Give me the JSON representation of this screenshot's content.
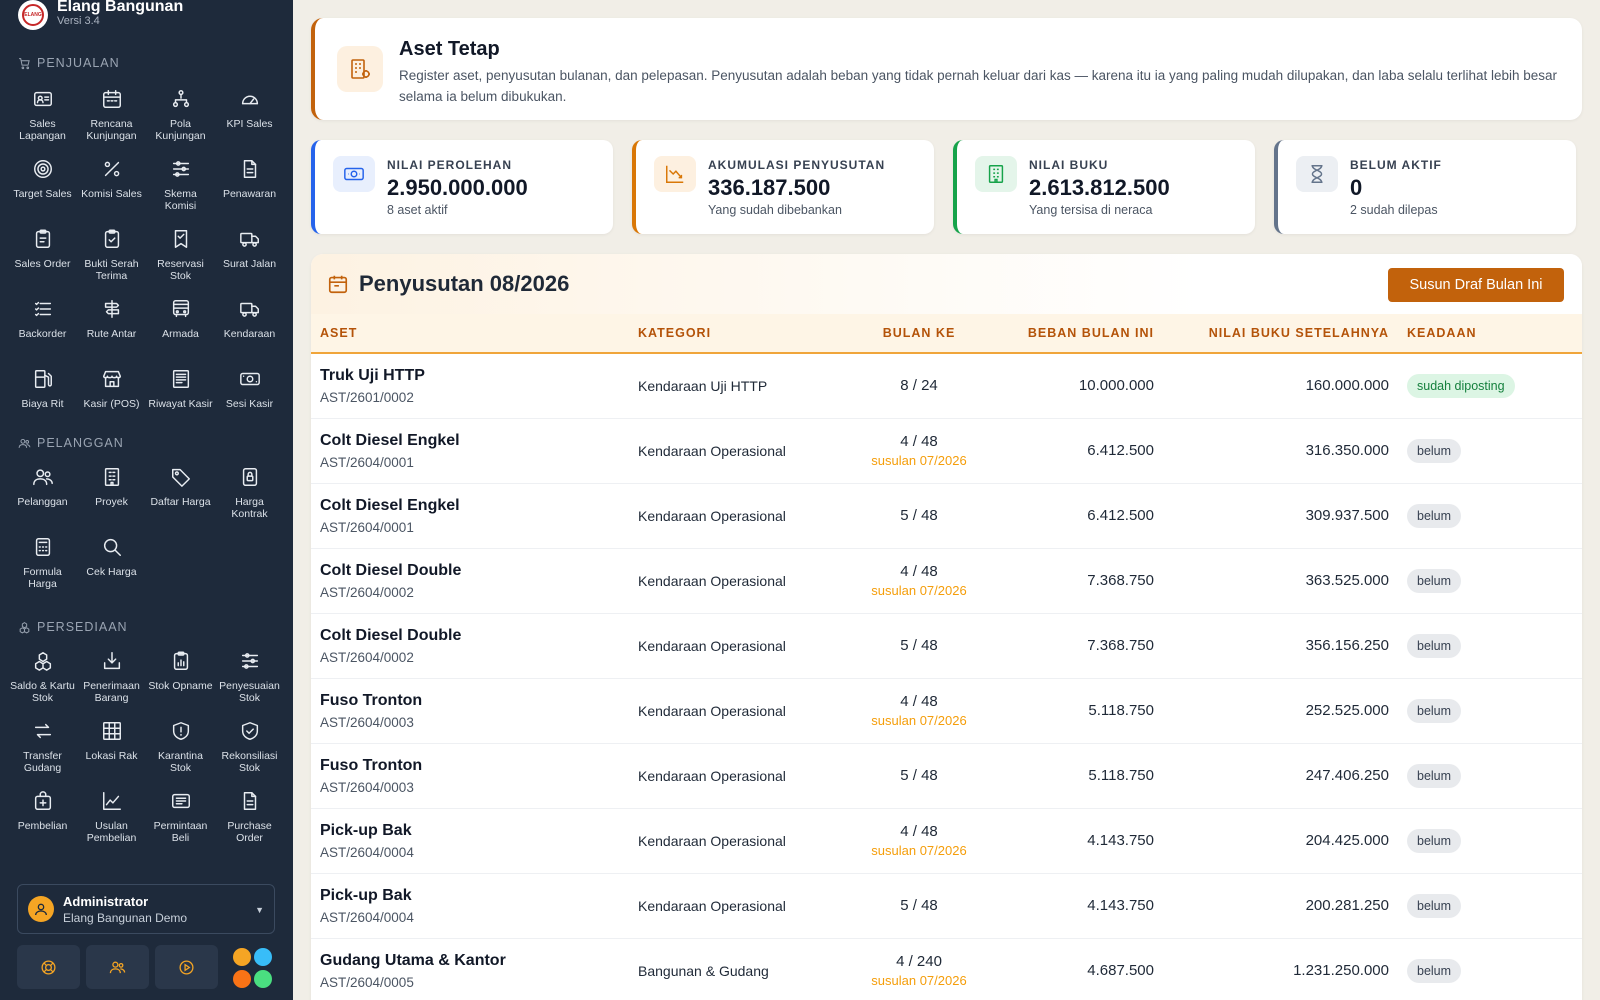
{
  "brand": {
    "name": "Elang Bangunan",
    "version": "Versi 3.4",
    "logo_text": "ELANG"
  },
  "sections": [
    {
      "title": "PENJUALAN",
      "icon": "cart-icon",
      "items": [
        {
          "label": "Sales Lapangan",
          "icon": "id-card-icon"
        },
        {
          "label": "Rencana Kunjungan",
          "icon": "calendar-icon"
        },
        {
          "label": "Pola Kunjungan",
          "icon": "network-icon"
        },
        {
          "label": "KPI Sales",
          "icon": "gauge-icon"
        },
        {
          "label": "Target Sales",
          "icon": "target-icon"
        },
        {
          "label": "Komisi Sales",
          "icon": "percent-icon"
        },
        {
          "label": "Skema Komisi",
          "icon": "sliders-icon"
        },
        {
          "label": "Penawaran",
          "icon": "document-icon"
        },
        {
          "label": "Sales Order",
          "icon": "clipboard-icon"
        },
        {
          "label": "Bukti Serah Terima",
          "icon": "clipboard-check-icon"
        },
        {
          "label": "Reservasi Stok",
          "icon": "bookmark-icon"
        },
        {
          "label": "Surat Jalan",
          "icon": "truck-icon"
        },
        {
          "label": "Backorder",
          "icon": "list-icon"
        },
        {
          "label": "Rute Antar",
          "icon": "signpost-icon"
        },
        {
          "label": "Armada",
          "icon": "bus-icon"
        },
        {
          "label": "Kendaraan",
          "icon": "truck-icon"
        },
        {
          "label": "Biaya Rit",
          "icon": "fuel-icon"
        },
        {
          "label": "Kasir (POS)",
          "icon": "store-icon"
        },
        {
          "label": "Riwayat Kasir",
          "icon": "receipt-icon"
        },
        {
          "label": "Sesi Kasir",
          "icon": "cash-icon"
        }
      ]
    },
    {
      "title": "PELANGGAN",
      "icon": "users-icon",
      "items": [
        {
          "label": "Pelanggan",
          "icon": "users-icon"
        },
        {
          "label": "Proyek",
          "icon": "building-icon"
        },
        {
          "label": "Daftar Harga",
          "icon": "tag-icon"
        },
        {
          "label": "Harga Kontrak",
          "icon": "lock-icon"
        },
        {
          "label": "Formula Harga",
          "icon": "calculator-icon"
        },
        {
          "label": "Cek Harga",
          "icon": "search-icon"
        }
      ]
    },
    {
      "title": "PERSEDIAAN",
      "icon": "boxes-icon",
      "items": [
        {
          "label": "Saldo & Kartu Stok",
          "icon": "boxes-icon"
        },
        {
          "label": "Penerimaan Barang",
          "icon": "download-tray-icon"
        },
        {
          "label": "Stok Opname",
          "icon": "clipboard-chart-icon"
        },
        {
          "label": "Penyesuaian Stok",
          "icon": "sliders-icon"
        },
        {
          "label": "Transfer Gudang",
          "icon": "arrows-icon"
        },
        {
          "label": "Lokasi Rak",
          "icon": "grid-icon"
        },
        {
          "label": "Karantina Stok",
          "icon": "shield-alert-icon"
        },
        {
          "label": "Rekonsiliasi Stok",
          "icon": "shield-check-icon"
        },
        {
          "label": "Pembelian",
          "icon": "bag-plus-icon"
        },
        {
          "label": "Usulan Pembelian",
          "icon": "chart-line-icon"
        },
        {
          "label": "Permintaan Beli",
          "icon": "form-icon"
        },
        {
          "label": "Purchase Order",
          "icon": "document-icon"
        }
      ]
    }
  ],
  "user": {
    "name": "Administrator",
    "org": "Elang Bangunan Demo"
  },
  "header": {
    "title": "Aset Tetap",
    "description": "Register aset, penyusutan bulanan, dan pelepasan. Penyusutan adalah beban yang tidak pernah keluar dari kas — karena itu ia yang paling mudah dilupakan, dan laba selalu terlihat lebih besar selama ia belum dibukukan."
  },
  "kpis": [
    {
      "label": "NILAI PEROLEHAN",
      "value": "2.950.000.000",
      "sub": "8 aset aktif",
      "color": "#2563eb",
      "icon": "money-icon"
    },
    {
      "label": "AKUMULASI PENYUSUTAN",
      "value": "336.187.500",
      "sub": "Yang sudah dibebankan",
      "color": "#d97706",
      "icon": "chart-down-icon"
    },
    {
      "label": "NILAI BUKU",
      "value": "2.613.812.500",
      "sub": "Yang tersisa di neraca",
      "color": "#16a34a",
      "icon": "building-icon"
    },
    {
      "label": "BELUM AKTIF",
      "value": "0",
      "sub": "2 sudah dilepas",
      "color": "#64748b",
      "icon": "hourglass-icon"
    }
  ],
  "depreciation": {
    "title": "Penyusutan 08/2026",
    "button": "Susun Draf Bulan Ini",
    "columns": [
      "ASET",
      "KATEGORI",
      "BULAN KE",
      "BEBAN BULAN INI",
      "NILAI BUKU SETELAHNYA",
      "KEADAAN"
    ],
    "rows": [
      {
        "name": "Truk Uji HTTP",
        "code": "AST/2601/0002",
        "category": "Kendaraan Uji HTTP",
        "month": "8 / 24",
        "late": "",
        "expense": "10.000.000",
        "book": "160.000.000",
        "status": "sudah diposting",
        "posted": true
      },
      {
        "name": "Colt Diesel Engkel",
        "code": "AST/2604/0001",
        "category": "Kendaraan Operasional",
        "month": "4 / 48",
        "late": "susulan 07/2026",
        "expense": "6.412.500",
        "book": "316.350.000",
        "status": "belum",
        "posted": false
      },
      {
        "name": "Colt Diesel Engkel",
        "code": "AST/2604/0001",
        "category": "Kendaraan Operasional",
        "month": "5 / 48",
        "late": "",
        "expense": "6.412.500",
        "book": "309.937.500",
        "status": "belum",
        "posted": false
      },
      {
        "name": "Colt Diesel Double",
        "code": "AST/2604/0002",
        "category": "Kendaraan Operasional",
        "month": "4 / 48",
        "late": "susulan 07/2026",
        "expense": "7.368.750",
        "book": "363.525.000",
        "status": "belum",
        "posted": false
      },
      {
        "name": "Colt Diesel Double",
        "code": "AST/2604/0002",
        "category": "Kendaraan Operasional",
        "month": "5 / 48",
        "late": "",
        "expense": "7.368.750",
        "book": "356.156.250",
        "status": "belum",
        "posted": false
      },
      {
        "name": "Fuso Tronton",
        "code": "AST/2604/0003",
        "category": "Kendaraan Operasional",
        "month": "4 / 48",
        "late": "susulan 07/2026",
        "expense": "5.118.750",
        "book": "252.525.000",
        "status": "belum",
        "posted": false
      },
      {
        "name": "Fuso Tronton",
        "code": "AST/2604/0003",
        "category": "Kendaraan Operasional",
        "month": "5 / 48",
        "late": "",
        "expense": "5.118.750",
        "book": "247.406.250",
        "status": "belum",
        "posted": false
      },
      {
        "name": "Pick-up Bak",
        "code": "AST/2604/0004",
        "category": "Kendaraan Operasional",
        "month": "4 / 48",
        "late": "susulan 07/2026",
        "expense": "4.143.750",
        "book": "204.425.000",
        "status": "belum",
        "posted": false
      },
      {
        "name": "Pick-up Bak",
        "code": "AST/2604/0004",
        "category": "Kendaraan Operasional",
        "month": "5 / 48",
        "late": "",
        "expense": "4.143.750",
        "book": "200.281.250",
        "status": "belum",
        "posted": false
      },
      {
        "name": "Gudang Utama & Kantor",
        "code": "AST/2604/0005",
        "category": "Bangunan & Gudang",
        "month": "4 / 240",
        "late": "susulan 07/2026",
        "expense": "4.687.500",
        "book": "1.231.250.000",
        "status": "belum",
        "posted": false
      }
    ]
  }
}
